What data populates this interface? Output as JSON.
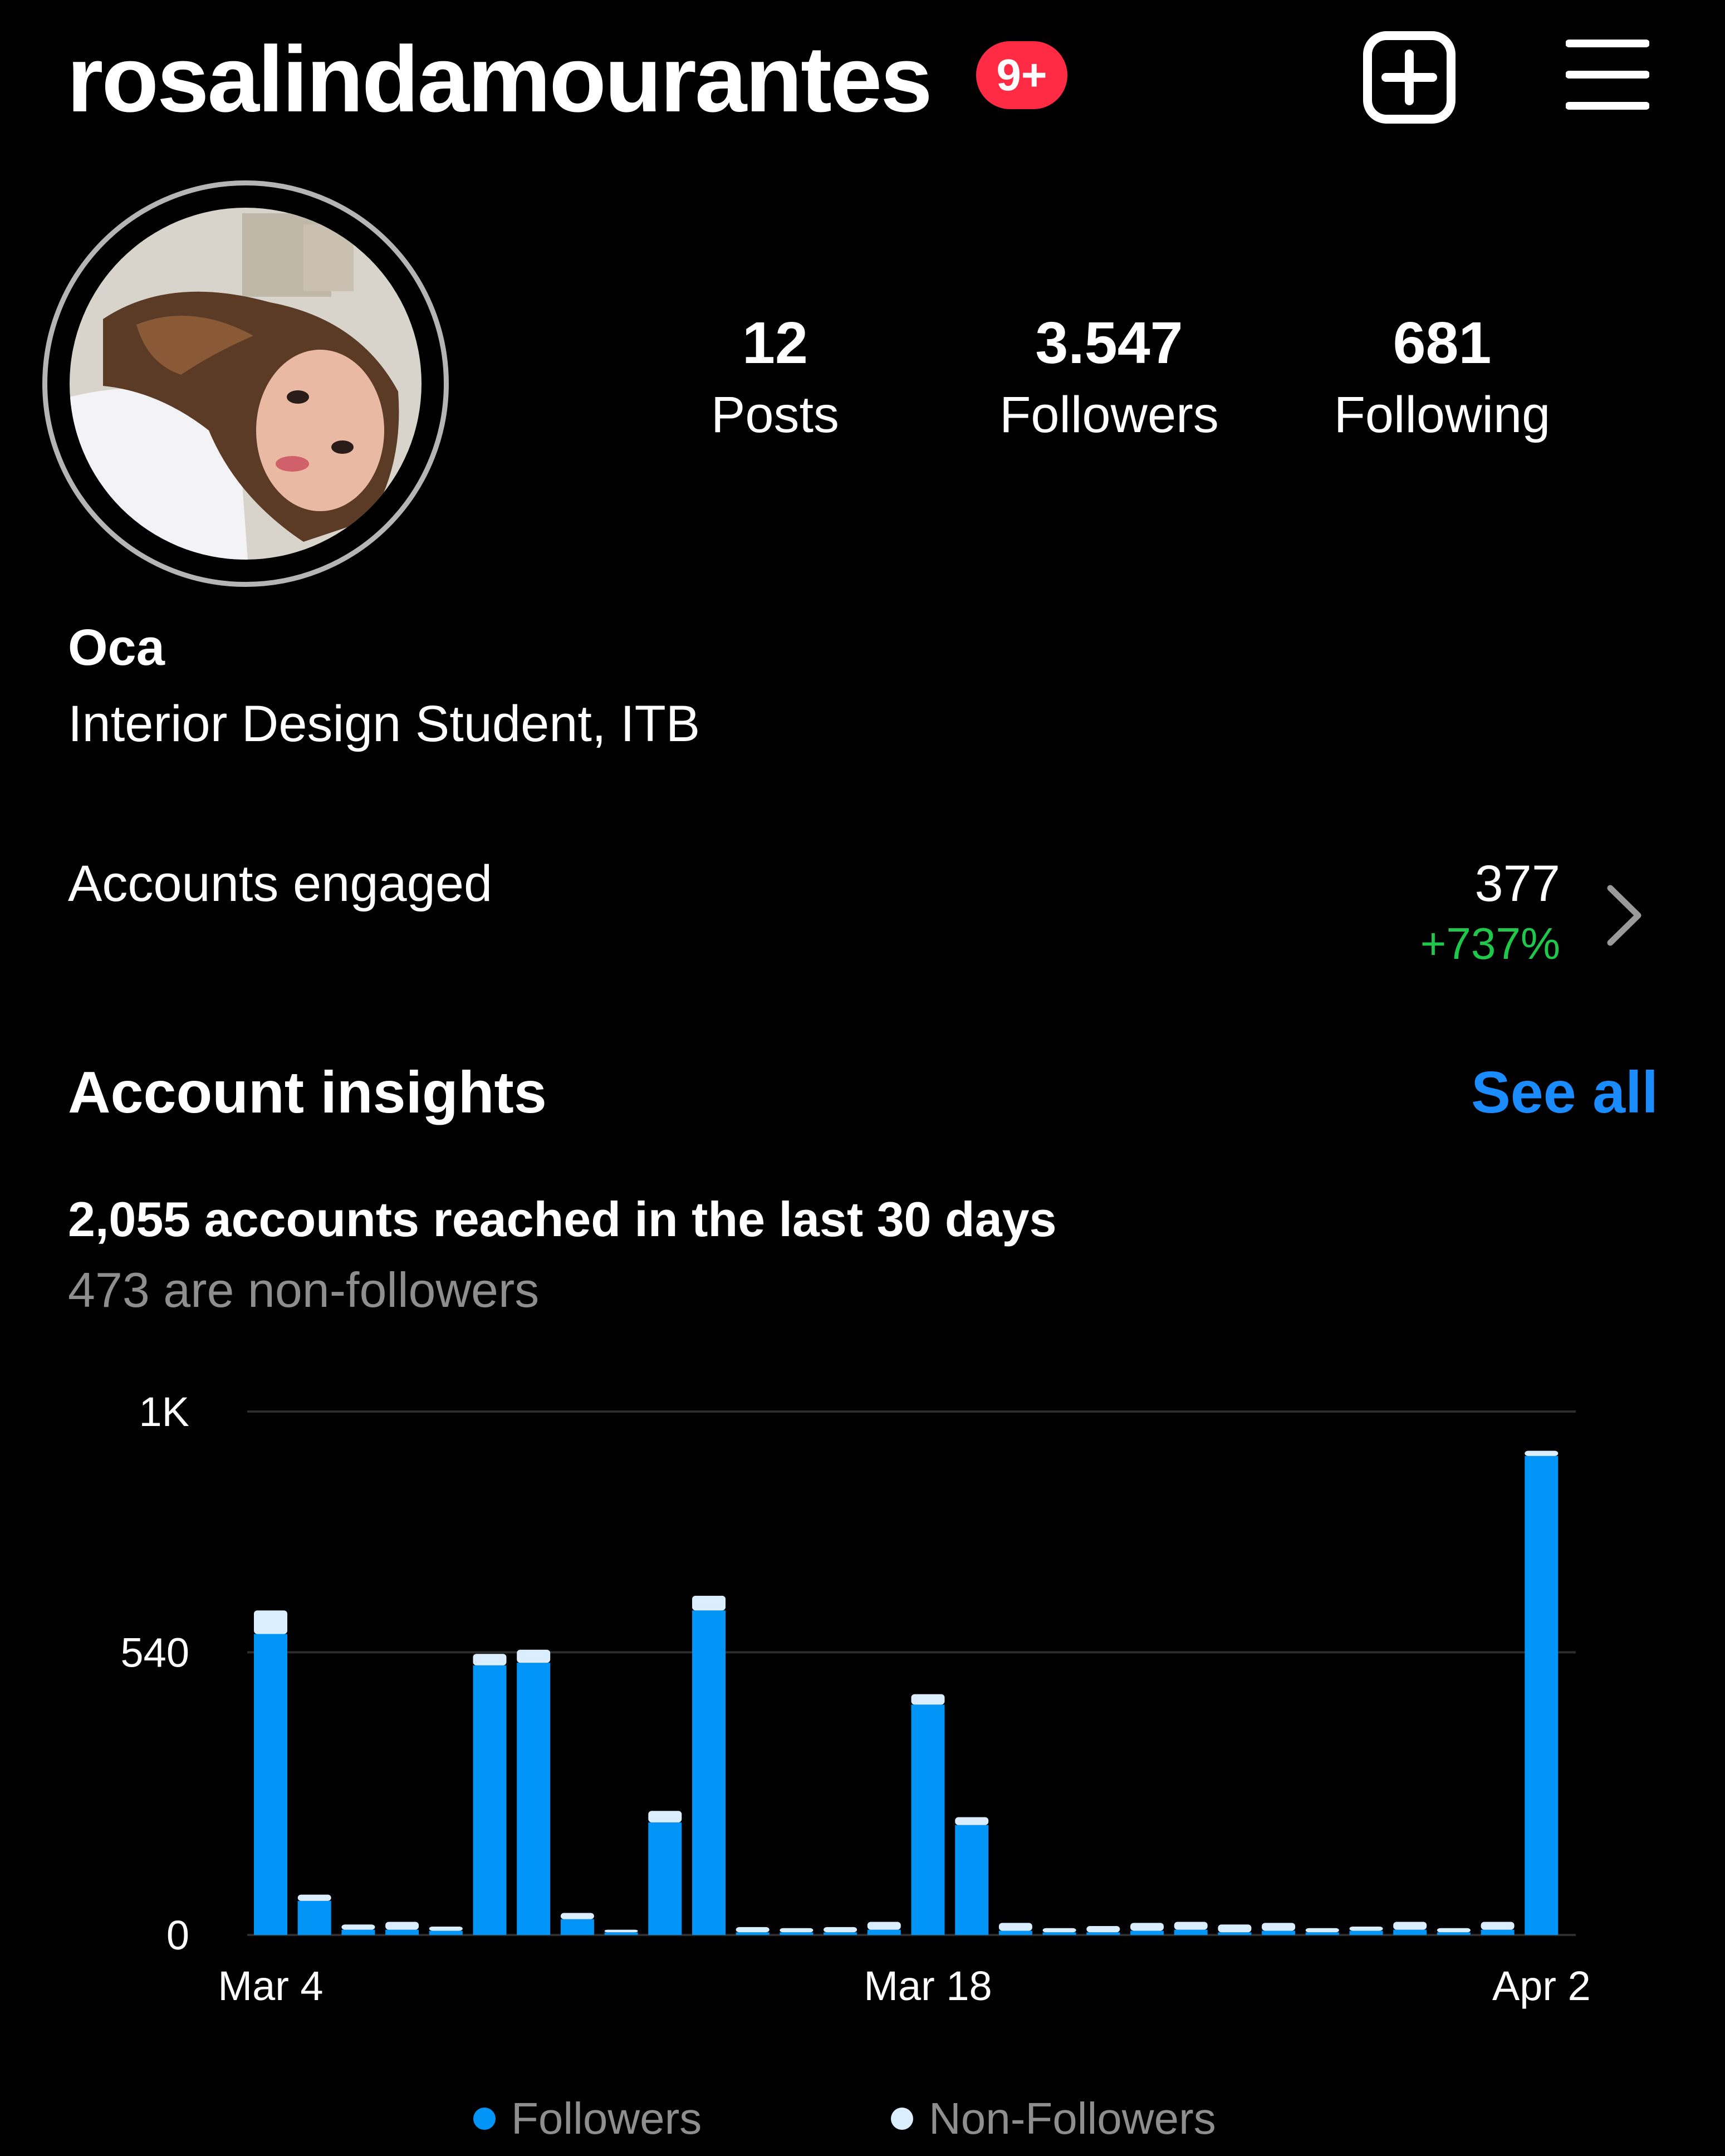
{
  "header": {
    "username": "rosalindamourantes",
    "notification_badge": "9+",
    "new_post_icon": "plus-square-icon",
    "menu_icon": "hamburger-menu-icon"
  },
  "profile": {
    "avatar_icon": "profile-photo",
    "stats": [
      {
        "value": "12",
        "label": "Posts"
      },
      {
        "value": "3.547",
        "label": "Followers"
      },
      {
        "value": "681",
        "label": "Following"
      }
    ],
    "name": "Oca",
    "bio": "Interior Design Student, ITB"
  },
  "engagement": {
    "label": "Accounts engaged",
    "value": "377",
    "change": "+737%",
    "chevron_icon": "chevron-right-icon"
  },
  "insights": {
    "title": "Account insights",
    "see_all": "See all",
    "reached": "2,055 accounts reached in the last 30 days",
    "non_followers": "473 are non-followers"
  },
  "colors": {
    "background": "#000000",
    "followers": "#0095f6",
    "non_followers": "#dbeeff",
    "positive": "#1fc84a",
    "link": "#1a8cff",
    "badge": "#ff2b45"
  },
  "chart_data": {
    "type": "bar",
    "stacked": true,
    "yticks": [
      "1K",
      "540",
      "0"
    ],
    "ytick_values": [
      1000,
      540,
      0
    ],
    "xticks": [
      "Mar 4",
      "Mar 18",
      "Apr 2"
    ],
    "ylim": [
      0,
      1000
    ],
    "series": [
      {
        "name": "Followers",
        "values": [
          575,
          65,
          10,
          10,
          8,
          515,
          520,
          30,
          5,
          215,
          620,
          5,
          5,
          5,
          10,
          440,
          210,
          8,
          5,
          5,
          8,
          10,
          5,
          8,
          5,
          8,
          10,
          5,
          10,
          915
        ]
      },
      {
        "name": "Non-Followers",
        "values": [
          45,
          12,
          10,
          15,
          8,
          22,
          25,
          12,
          5,
          22,
          28,
          10,
          8,
          10,
          15,
          20,
          15,
          15,
          8,
          12,
          15,
          15,
          15,
          15,
          8,
          8,
          15,
          8,
          15,
          10
        ]
      }
    ],
    "legend": [
      "Followers",
      "Non-Followers"
    ],
    "legend_position": "bottom",
    "grid": true
  }
}
